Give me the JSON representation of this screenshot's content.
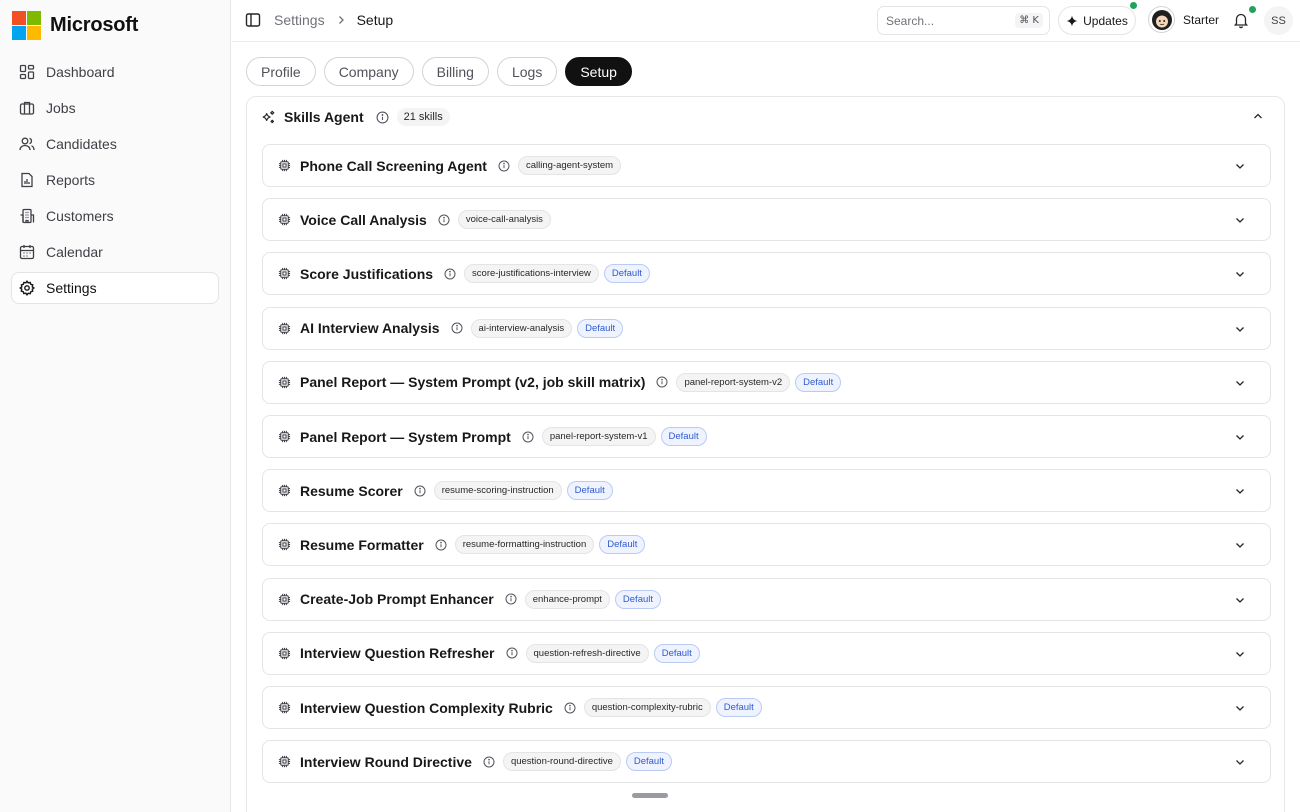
{
  "brand": {
    "name": "Microsoft",
    "logo_colors": [
      "#f25022",
      "#7fba00",
      "#00a4ef",
      "#ffb900"
    ]
  },
  "sidebar": {
    "items": [
      {
        "label": "Dashboard",
        "icon": "dashboard-icon",
        "active": false
      },
      {
        "label": "Jobs",
        "icon": "briefcase-icon",
        "active": false
      },
      {
        "label": "Candidates",
        "icon": "users-icon",
        "active": false
      },
      {
        "label": "Reports",
        "icon": "report-icon",
        "active": false
      },
      {
        "label": "Customers",
        "icon": "building-icon",
        "active": false
      },
      {
        "label": "Calendar",
        "icon": "calendar-icon",
        "active": false
      },
      {
        "label": "Settings",
        "icon": "gear-icon",
        "active": true
      }
    ]
  },
  "header": {
    "breadcrumb": [
      "Settings",
      "Setup"
    ],
    "search": {
      "placeholder": "Search...",
      "shortcut": "⌘ K"
    },
    "updates_label": "Updates",
    "plan_label": "Starter",
    "user_initials": "SS",
    "status_color": "#22a35a"
  },
  "tabs": [
    {
      "label": "Profile",
      "active": false
    },
    {
      "label": "Company",
      "active": false
    },
    {
      "label": "Billing",
      "active": false
    },
    {
      "label": "Logs",
      "active": false
    },
    {
      "label": "Setup",
      "active": true
    }
  ],
  "skills_agent": {
    "title": "Skills Agent",
    "count_label": "21 skills",
    "default_label": "Default",
    "items": [
      {
        "name": "Phone Call Screening Agent",
        "slug": "calling-agent-system",
        "is_default": false
      },
      {
        "name": "Voice Call Analysis",
        "slug": "voice-call-analysis",
        "is_default": false
      },
      {
        "name": "Score Justifications",
        "slug": "score-justifications-interview",
        "is_default": true
      },
      {
        "name": "AI Interview Analysis",
        "slug": "ai-interview-analysis",
        "is_default": true
      },
      {
        "name": "Panel Report — System Prompt (v2, job skill matrix)",
        "slug": "panel-report-system-v2",
        "is_default": true
      },
      {
        "name": "Panel Report — System Prompt",
        "slug": "panel-report-system-v1",
        "is_default": true
      },
      {
        "name": "Resume Scorer",
        "slug": "resume-scoring-instruction",
        "is_default": true
      },
      {
        "name": "Resume Formatter",
        "slug": "resume-formatting-instruction",
        "is_default": true
      },
      {
        "name": "Create-Job Prompt Enhancer",
        "slug": "enhance-prompt",
        "is_default": true
      },
      {
        "name": "Interview Question Refresher",
        "slug": "question-refresh-directive",
        "is_default": true
      },
      {
        "name": "Interview Question Complexity Rubric",
        "slug": "question-complexity-rubric",
        "is_default": true
      },
      {
        "name": "Interview Round Directive",
        "slug": "question-round-directive",
        "is_default": true
      }
    ]
  }
}
